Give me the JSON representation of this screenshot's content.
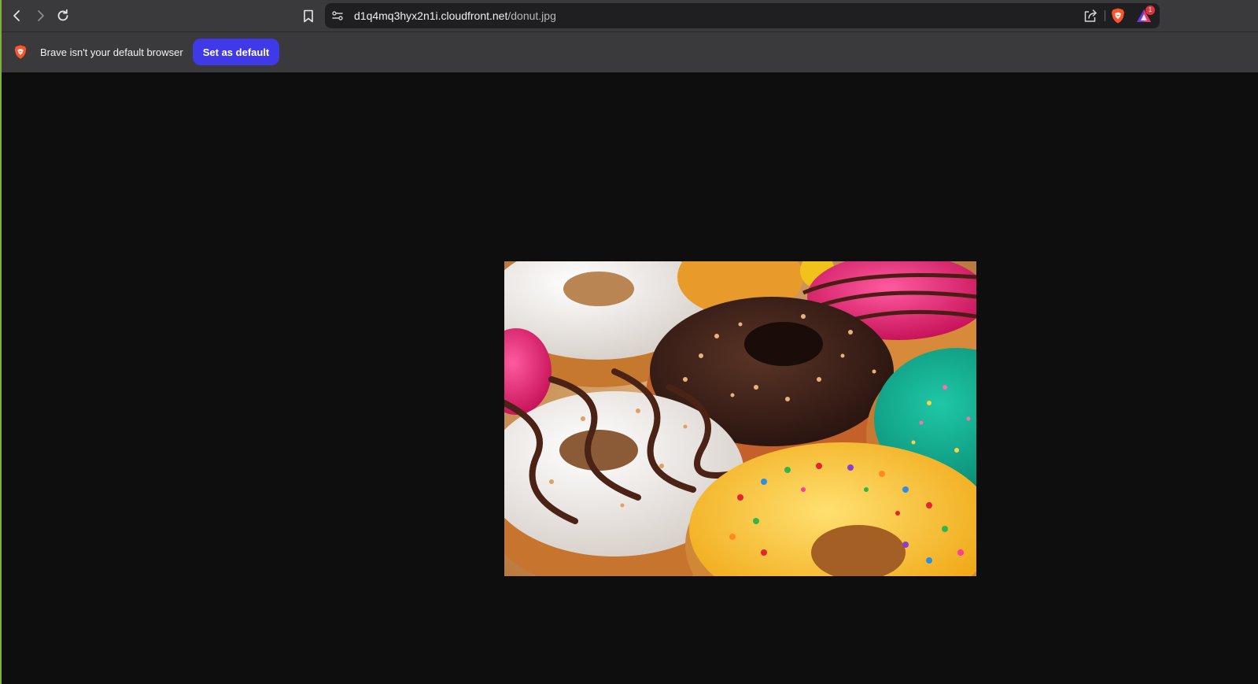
{
  "toolbar": {
    "back_icon": "chevron-left-icon",
    "forward_icon": "chevron-right-icon",
    "reload_icon": "reload-icon",
    "bookmark_icon": "bookmark-icon",
    "url_host": "d1q4mq3hyx2n1i.cloudfront.net",
    "url_path": "/donut.jpg",
    "share_icon": "share-icon",
    "shield_icon": "brave-shield-icon",
    "rewards_icon": "brave-rewards-icon",
    "rewards_badge": "1"
  },
  "infobar": {
    "message": "Brave isn't your default browser",
    "button_label": "Set as default",
    "button_color": "#3f39e8"
  },
  "viewer": {
    "background": "#0e0e0e",
    "image_subject": "donut-photo"
  }
}
